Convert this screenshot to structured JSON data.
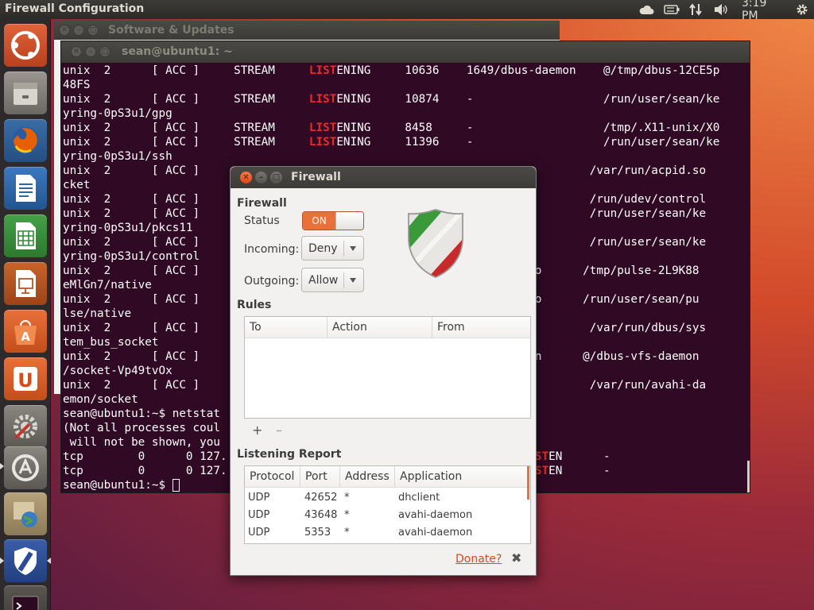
{
  "topbar": {
    "title": "Firewall Configuration",
    "time": "3:19 PM",
    "icons": [
      "cloud-icon",
      "battery-icon",
      "network-icon",
      "volume-icon",
      "gear-icon"
    ]
  },
  "launcher": {
    "items": [
      "ubuntu-dash",
      "files",
      "firefox",
      "libreoffice-writer",
      "libreoffice-calc",
      "libreoffice-impress",
      "ubuntu-software-center",
      "ubuntu-one",
      "system-settings",
      "software-updater",
      "workspace-switcher",
      "gufw",
      "terminal"
    ]
  },
  "software_updates": {
    "title": "Software & Updates"
  },
  "terminal": {
    "title": "sean@ubuntu1: ~",
    "lines": [
      {
        "pre": "unix  2      [ ACC ]     STREAM     ",
        "hl": "LIST",
        "post": "ENING     10636    1649/dbus-daemon    @/tmp/dbus-12CE5p"
      },
      {
        "pre": "48FS",
        "hl": "",
        "post": ""
      },
      {
        "pre": "unix  2      [ ACC ]     STREAM     ",
        "hl": "LIST",
        "post": "ENING     10874    -                   /run/user/sean/ke"
      },
      {
        "pre": "yring-0pS3u1/gpg",
        "hl": "",
        "post": ""
      },
      {
        "pre": "unix  2      [ ACC ]     STREAM     ",
        "hl": "LIST",
        "post": "ENING     8458     -                   /tmp/.X11-unix/X0"
      },
      {
        "pre": "unix  2      [ ACC ]     STREAM     ",
        "hl": "LIST",
        "post": "ENING     11396    -                   /run/user/sean/ke"
      },
      {
        "pre": "yring-0pS3u1/ssh",
        "hl": "",
        "post": ""
      },
      {
        "pre": "unix  2      [ ACC ]                                                         /var/run/acpid.so",
        "hl": "",
        "post": ""
      },
      {
        "pre": "cket",
        "hl": "",
        "post": ""
      },
      {
        "pre": "unix  2      [ ACC ]                                                         /run/udev/control",
        "hl": "",
        "post": ""
      },
      {
        "pre": "unix  2      [ ACC ]                                                         /run/user/sean/ke",
        "hl": "",
        "post": ""
      },
      {
        "pre": "yring-0pS3u1/pkcs11",
        "hl": "",
        "post": ""
      },
      {
        "pre": "unix  2      [ ACC ]                                                         /run/user/sean/ke",
        "hl": "",
        "post": ""
      },
      {
        "pre": "yring-0pS3u1/control",
        "hl": "",
        "post": ""
      },
      {
        "pre": "unix  2      [ ACC ]                                          lseaudio      /tmp/pulse-2L9K88",
        "hl": "",
        "post": ""
      },
      {
        "pre": "eMlGn7/native",
        "hl": "",
        "post": ""
      },
      {
        "pre": "unix  2      [ ACC ]                                          lseaudio      /run/user/sean/pu",
        "hl": "",
        "post": ""
      },
      {
        "pre": "lse/native",
        "hl": "",
        "post": ""
      },
      {
        "pre": "unix  2      [ ACC ]                                                         /var/run/dbus/sys",
        "hl": "",
        "post": ""
      },
      {
        "pre": "tem_bus_socket",
        "hl": "",
        "post": ""
      },
      {
        "pre": "unix  2      [ ACC ]                                          fsd-burn      @/dbus-vfs-daemon",
        "hl": "",
        "post": ""
      },
      {
        "pre": "/socket-Vp49tvOx",
        "hl": "",
        "post": ""
      },
      {
        "pre": "unix  2      [ ACC ]                                                         /var/run/avahi-da",
        "hl": "",
        "post": ""
      },
      {
        "pre": "emon/socket",
        "hl": "",
        "post": ""
      },
      {
        "pre": "sean@ubuntu1:~$ netstat",
        "hl": "",
        "post": ""
      },
      {
        "pre": "(Not all processes coul",
        "hl": "",
        "post": ""
      },
      {
        "pre": " will not be shown, you",
        "hl": "",
        "post": ""
      },
      {
        "pre": "tcp        0      0 127.                                           ",
        "hl": "LIST",
        "post": "EN      -"
      },
      {
        "pre": "tcp        0      0 127.                                           ",
        "hl": "LIST",
        "post": "EN      -"
      },
      {
        "pre": "sean@ubuntu1:~$ ",
        "hl": "",
        "post": "",
        "cursor": true
      }
    ]
  },
  "firewall": {
    "title": "Firewall",
    "section_firewall": "Firewall",
    "status_label": "Status",
    "status_value": "ON",
    "incoming_label": "Incoming:",
    "incoming_value": "Deny",
    "outgoing_label": "Outgoing:",
    "outgoing_value": "Allow",
    "rules_label": "Rules",
    "rules_columns": [
      "To",
      "Action",
      "From"
    ],
    "add": "+",
    "remove": "–",
    "report_label": "Listening Report",
    "report_columns": [
      "Protocol",
      "Port",
      "Address",
      "Application"
    ],
    "report_rows": [
      {
        "protocol": "UDP",
        "port": "42652",
        "address": "*",
        "application": "dhclient"
      },
      {
        "protocol": "UDP",
        "port": "43648",
        "address": "*",
        "application": "avahi-daemon"
      },
      {
        "protocol": "UDP",
        "port": "5353",
        "address": "*",
        "application": "avahi-daemon"
      }
    ],
    "donate": "Donate?",
    "close": "✖",
    "accent": "#e9703a"
  }
}
